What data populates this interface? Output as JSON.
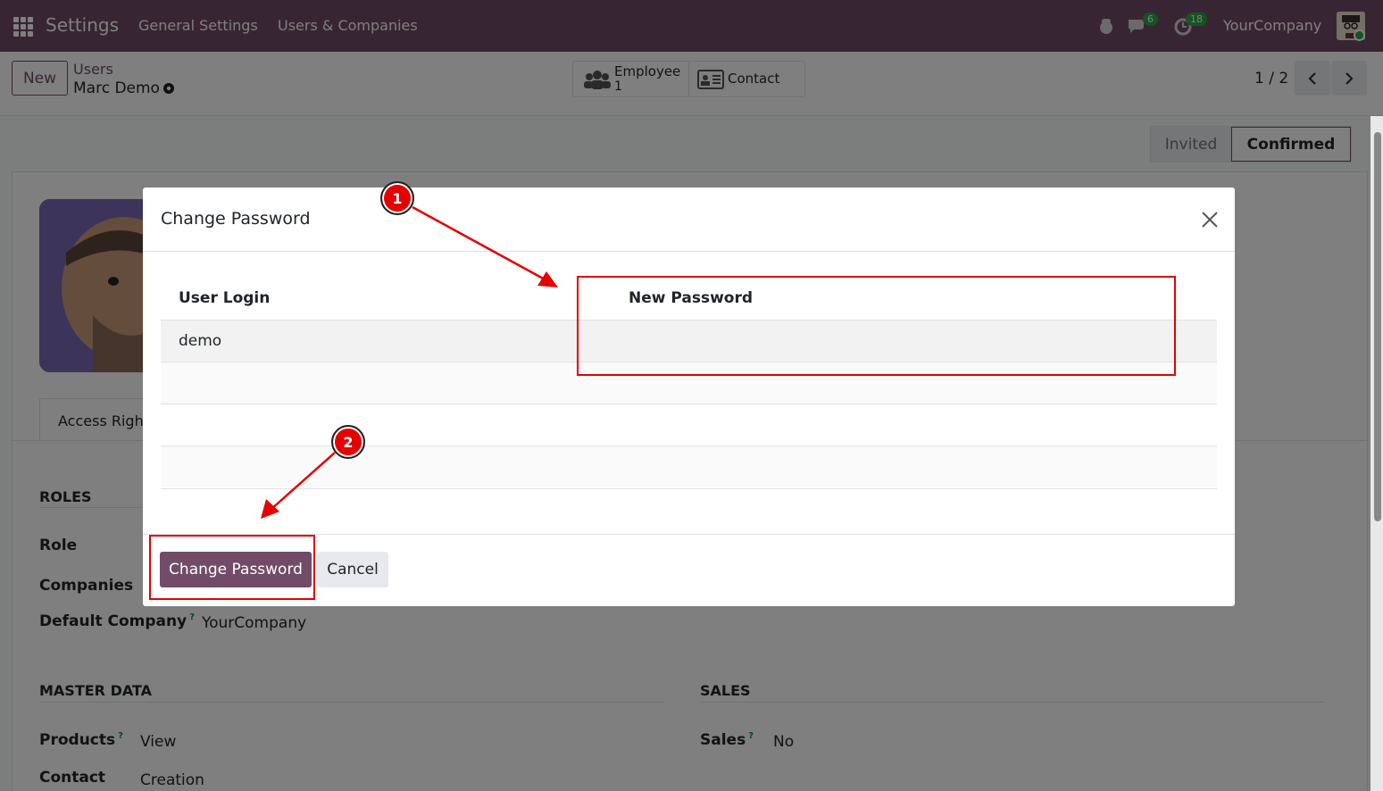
{
  "nav": {
    "app_title": "Settings",
    "menu": [
      "General Settings",
      "Users & Companies"
    ],
    "messages_badge": "6",
    "activities_badge": "18",
    "company": "YourCompany"
  },
  "control": {
    "new_label": "New",
    "breadcrumb_parent": "Users",
    "breadcrumb_current": "Marc Demo",
    "smart_employee_label": "Employee",
    "smart_employee_count": "1",
    "smart_contact_label": "Contact",
    "pager": "1 / 2"
  },
  "status": {
    "invited": "Invited",
    "confirmed": "Confirmed"
  },
  "form": {
    "tab_access": "Access Rights",
    "roles_title": "ROLES",
    "role_label": "Role",
    "companies_label": "Companies",
    "default_company_label": "Default Company",
    "default_company_value": "YourCompany",
    "master_data_title": "MASTER DATA",
    "products_label": "Products",
    "products_value": "View",
    "contact_label": "Contact",
    "contact_value": "Creation",
    "sales_title": "SALES",
    "sales_label": "Sales",
    "sales_value": "No",
    "help_mark": "?"
  },
  "modal": {
    "title": "Change Password",
    "col_login": "User Login",
    "col_password": "New Password",
    "rows": [
      {
        "login": "demo",
        "password": ""
      }
    ],
    "primary_label": "Change Password",
    "cancel_label": "Cancel"
  },
  "annotations": {
    "step1": "1",
    "step2": "2",
    "color": "#e60000"
  },
  "colors": {
    "brand": "#714b67",
    "badge": "#28a745"
  }
}
